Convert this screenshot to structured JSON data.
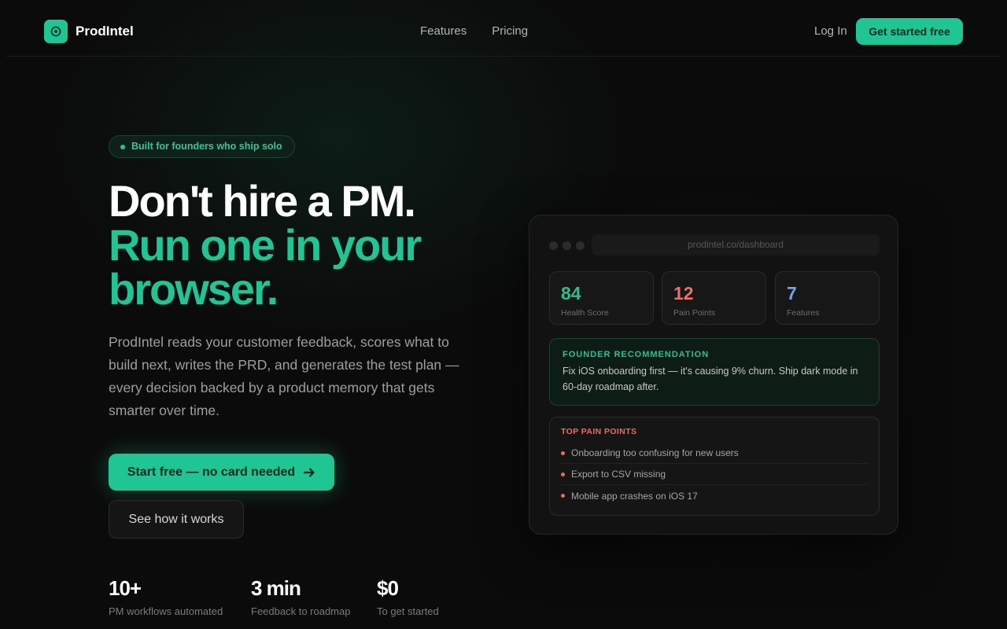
{
  "brand": {
    "name": "ProdIntel",
    "icon": "target-icon",
    "accent": "#1fc592"
  },
  "nav": {
    "links": [
      "Features",
      "Pricing"
    ],
    "login": "Log In",
    "cta": "Get started free"
  },
  "hero": {
    "badge": "Built for founders who ship solo",
    "headline_line1": "Don't hire a PM.",
    "headline_line2": "Run one in your browser.",
    "description": "ProdIntel reads your customer feedback, scores what to build next, writes the PRD, and generates the test plan — every decision backed by a product memory that gets smarter over time.",
    "primary_cta": "Start free — no card needed",
    "primary_cta_icon": "arrow-right-icon",
    "secondary_cta": "See how it works"
  },
  "stats": [
    {
      "value": "10+",
      "label": "PM workflows automated"
    },
    {
      "value": "3 min",
      "label": "Feedback to roadmap"
    },
    {
      "value": "$0",
      "label": "To get started"
    }
  ],
  "dashboard": {
    "url": "prodintel.co/dashboard",
    "metrics": [
      {
        "value": "84",
        "label": "Health Score",
        "color": "#2dbf8c"
      },
      {
        "value": "12",
        "label": "Pain Points",
        "color": "#ee6f63"
      },
      {
        "value": "7",
        "label": "Features",
        "color": "#6aa7f0"
      }
    ],
    "recommendation": {
      "title": "FOUNDER RECOMMENDATION",
      "body": "Fix iOS onboarding first — it's causing 9% churn. Ship dark mode in 60-day roadmap after."
    },
    "pain_points": {
      "title": "TOP PAIN POINTS",
      "items": [
        "Onboarding too confusing for new users",
        "Export to CSV missing",
        "Mobile app crashes on iOS 17"
      ]
    }
  }
}
